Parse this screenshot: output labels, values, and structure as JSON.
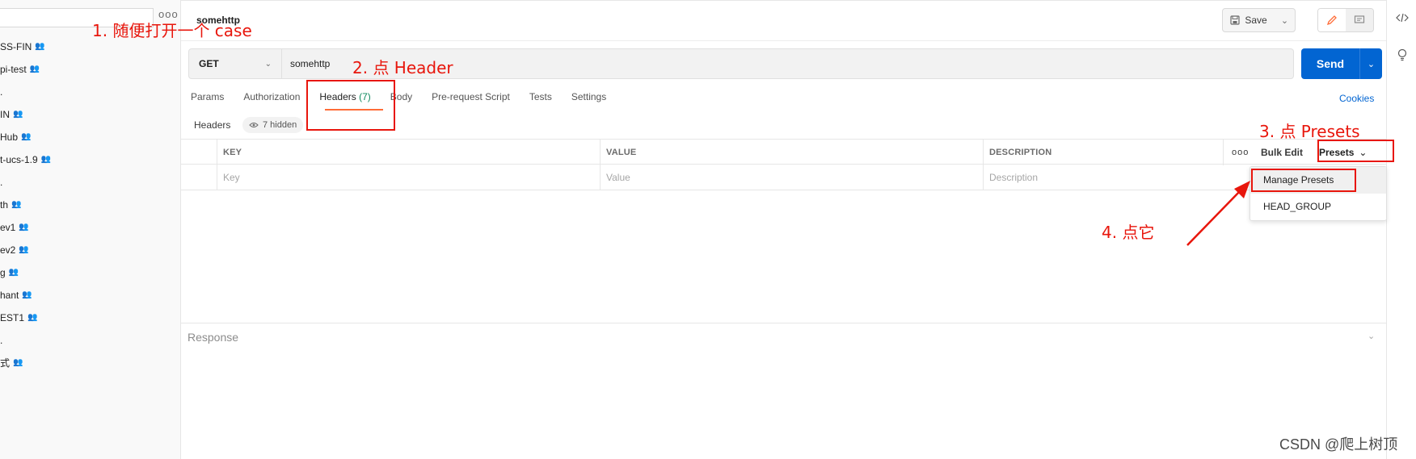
{
  "sidebar": {
    "items": [
      {
        "label": "SS-FIN"
      },
      {
        "label": "pi-test"
      },
      {
        "label": "."
      },
      {
        "label": "IN"
      },
      {
        "label": "Hub"
      },
      {
        "label": "t-ucs-1.9"
      },
      {
        "label": "."
      },
      {
        "label": "th"
      },
      {
        "label": "ev1"
      },
      {
        "label": "ev2"
      },
      {
        "label": "g"
      },
      {
        "label": "hant"
      },
      {
        "label": "EST1"
      },
      {
        "label": "."
      },
      {
        "label": "式"
      }
    ],
    "more_glyph": "ooo",
    "people_glyph": "👥"
  },
  "request": {
    "tab_title": "somehttp",
    "method": "GET",
    "url": "somehttp",
    "send_label": "Send",
    "save_label": "Save"
  },
  "tabs": [
    {
      "label": "Params"
    },
    {
      "label": "Authorization"
    },
    {
      "label": "Headers",
      "count": "(7)"
    },
    {
      "label": "Body"
    },
    {
      "label": "Pre-request Script"
    },
    {
      "label": "Tests"
    },
    {
      "label": "Settings"
    }
  ],
  "cookies_label": "Cookies",
  "headers_section": {
    "title": "Headers",
    "hidden_label": "7 hidden",
    "columns": {
      "key": "KEY",
      "value": "VALUE",
      "description": "DESCRIPTION"
    },
    "placeholders": {
      "key": "Key",
      "value": "Value",
      "description": "Description"
    },
    "dots": "ooo",
    "bulk_edit": "Bulk Edit",
    "presets": "Presets"
  },
  "presets_menu": {
    "items": [
      {
        "label": "Manage Presets"
      },
      {
        "label": "HEAD_GROUP"
      }
    ]
  },
  "response": {
    "label": "Response"
  },
  "annotations": {
    "step1": "1. 随便打开一个 case",
    "step2": "2. 点 Header",
    "step3": "3. 点 Presets",
    "step4": "4. 点它",
    "color": "#e8160c"
  },
  "watermark": "CSDN @爬上树顶",
  "colors": {
    "send": "#0265d2",
    "accent": "#ff6c37",
    "count": "#0f8a5f"
  }
}
